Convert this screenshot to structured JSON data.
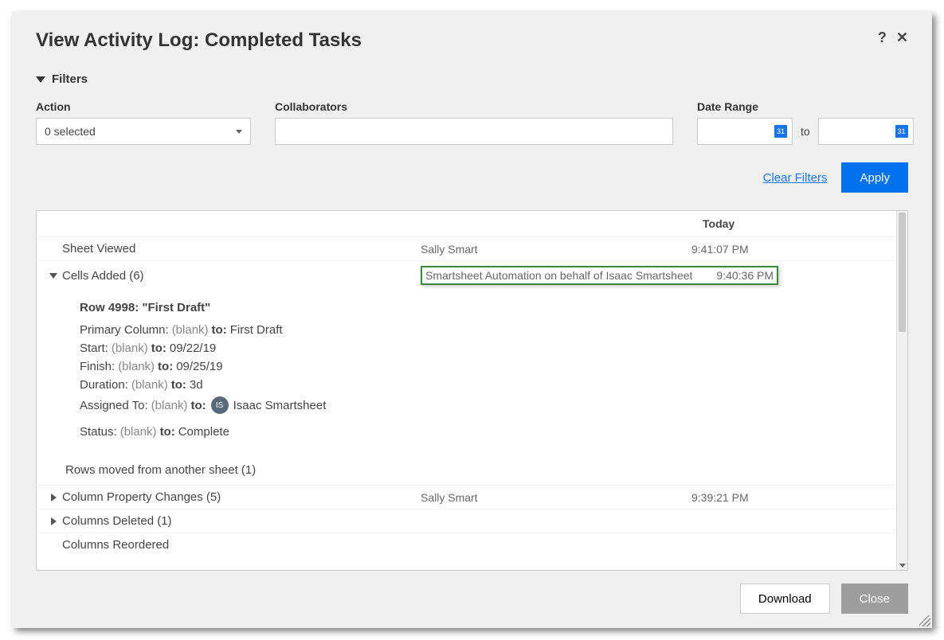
{
  "dialog": {
    "title": "View Activity Log: Completed Tasks"
  },
  "filters": {
    "section_label": "Filters",
    "action_label": "Action",
    "action_selected": "0 selected",
    "collaborators_label": "Collaborators",
    "date_range_label": "Date Range",
    "to_label": "to",
    "clear_label": "Clear Filters",
    "apply_label": "Apply"
  },
  "log": {
    "date_header": "Today",
    "rows": [
      {
        "action": "Sheet Viewed",
        "actor": "Sally Smart",
        "time": "9:41:07 PM"
      },
      {
        "action": "Cells Added (6)",
        "actor": "Smartsheet Automation on behalf of Isaac Smartsheet",
        "time": "9:40:36 PM"
      },
      {
        "action": "Column Property Changes (5)",
        "actor": "Sally Smart",
        "time": "9:39:21 PM"
      },
      {
        "action": "Columns Deleted (1)",
        "actor": "",
        "time": ""
      },
      {
        "action": "Columns Reordered",
        "actor": "",
        "time": ""
      }
    ],
    "detail": {
      "row_title": "Row 4998: \"First Draft\"",
      "blank": "(blank)",
      "to": "to:",
      "primary_label": "Primary Column:",
      "primary_to": "First Draft",
      "start_label": "Start:",
      "start_to": "09/22/19",
      "finish_label": "Finish:",
      "finish_to": "09/25/19",
      "duration_label": "Duration:",
      "duration_to": "3d",
      "assigned_label": "Assigned To:",
      "assigned_initials": "IS",
      "assigned_to": "Isaac Smartsheet",
      "status_label": "Status:",
      "status_to": "Complete",
      "moved_rows": "Rows moved from another sheet (1)"
    }
  },
  "footer": {
    "download": "Download",
    "close": "Close"
  }
}
